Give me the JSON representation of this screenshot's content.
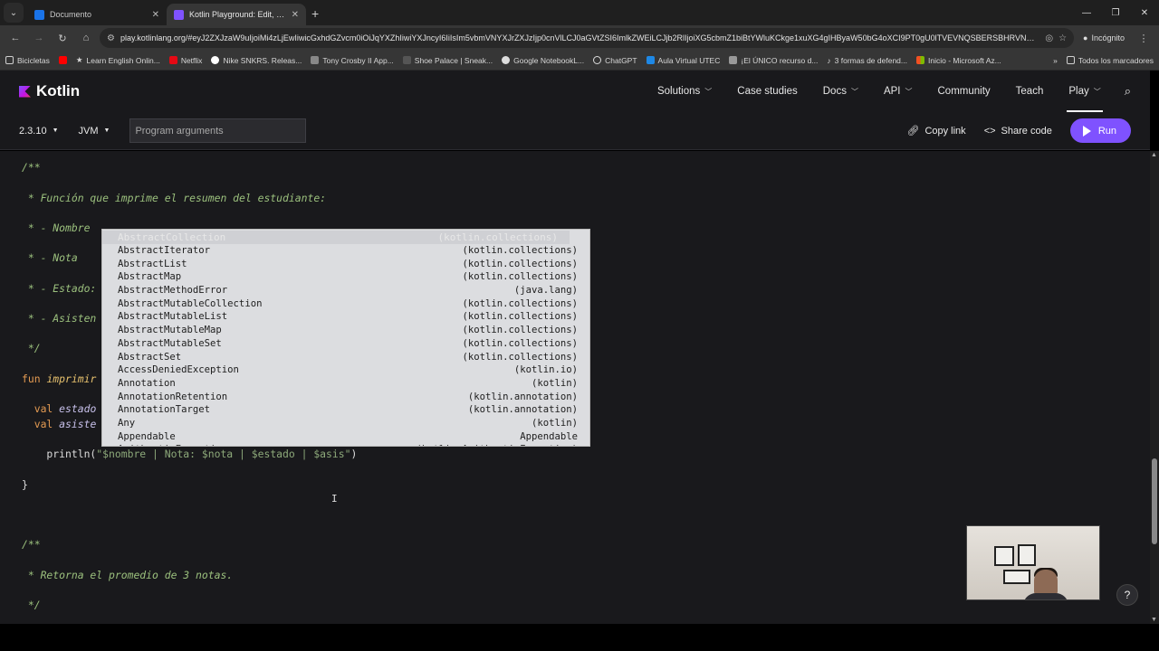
{
  "browser": {
    "tabs": [
      {
        "title": "Documento",
        "favicon_color": "#1a73e8",
        "active": false
      },
      {
        "title": "Kotlin Playground: Edit, Run, Sh",
        "favicon_color": "#7f52ff",
        "active": true
      }
    ],
    "url": "play.kotlinlang.org/#eyJ2ZXJzaW9uIjoiMi4zLjEwIiwicGxhdGZvcm0iOiJqYXZhIiwiYXJncyI6IiIsIm5vbmVNYXJrZXJzIjp0cnVlLCJ0aGVtZSI6ImlkZWEiLCJjb2RlIjoiXG5cbmZ1biBtYWluKCkge1xuXG4gIHByaW50bG4oXCI9PT0gU0lTVEVNQSBERSBHRVNUSU9OIERFIE",
    "incognito_label": "Incógnito",
    "bookmarks": [
      {
        "label": "Bicicletas",
        "color": "#cfcfcf"
      },
      {
        "label": "Learn English Onlin...",
        "color": "#ff0000"
      },
      {
        "label": "Learn English Onlin...",
        "color": "#cfcfcf"
      },
      {
        "label": "Netflix",
        "color": "#e50914"
      },
      {
        "label": "Nike SNKRS. Releas...",
        "color": "#ffffff"
      },
      {
        "label": "Tony Crosby II App...",
        "color": "#cfcfcf"
      },
      {
        "label": "Shoe Palace | Sneak...",
        "color": "#333333"
      },
      {
        "label": "Google NotebookL...",
        "color": "#cfcfcf"
      },
      {
        "label": "ChatGPT",
        "color": "#cfcfcf"
      },
      {
        "label": "Aula Virtual UTEC",
        "color": "#1e88e5"
      },
      {
        "label": "¡El ÚNICO recurso d...",
        "color": "#cfcfcf"
      },
      {
        "label": "3 formas de defend...",
        "color": "#cfcfcf"
      },
      {
        "label": "Inicio - Microsoft Az...",
        "color": "#f25022"
      }
    ],
    "all_bookmarks_label": "Todos los marcadores"
  },
  "kotlin": {
    "logo": "Kotlin",
    "nav": [
      {
        "label": "Solutions",
        "dropdown": true
      },
      {
        "label": "Case studies",
        "dropdown": false
      },
      {
        "label": "Docs",
        "dropdown": true
      },
      {
        "label": "API",
        "dropdown": true
      },
      {
        "label": "Community",
        "dropdown": false
      },
      {
        "label": "Teach",
        "dropdown": false
      },
      {
        "label": "Play",
        "dropdown": true
      }
    ],
    "toolbar": {
      "version": "2.3.10",
      "platform": "JVM",
      "args_placeholder": "Program arguments",
      "copy_link": "Copy link",
      "share_code": "Share code",
      "run": "Run"
    }
  },
  "code_lines": [
    {
      "t": "/**",
      "c": "cm"
    },
    {
      "t": "",
      "c": "cm"
    },
    {
      "t": " * Función que imprime el resumen del estudiante:",
      "c": "cm"
    },
    {
      "t": "",
      "c": "cm"
    },
    {
      "t": " * - Nombre",
      "c": "cm"
    },
    {
      "t": "",
      "c": "cm"
    },
    {
      "t": " * - Nota",
      "c": "cm"
    },
    {
      "t": "",
      "c": "cm"
    },
    {
      "t": " * - Estado:",
      "c": "cm"
    },
    {
      "t": "",
      "c": "cm"
    },
    {
      "t": " * - Asisten",
      "c": "cm"
    },
    {
      "t": "",
      "c": "cm"
    },
    {
      "t": " */",
      "c": "cm"
    },
    {
      "t": "",
      "c": "cm"
    }
  ],
  "code_fn": {
    "kw": "fun ",
    "name": "imprimir"
  },
  "code_vals": [
    {
      "kw": "  val ",
      "name": "estado"
    },
    {
      "kw": "  val ",
      "name": "asiste"
    }
  ],
  "code_println": {
    "fn": "    println(",
    "str": "\"$nombre | Nota: $nota | $estado | $asis\"",
    "end": ")"
  },
  "code_close": "}",
  "code_tail": [
    {
      "t": "/**"
    },
    {
      "t": ""
    },
    {
      "t": " * Retorna el promedio de 3 notas."
    },
    {
      "t": ""
    },
    {
      "t": " */"
    }
  ],
  "autocomplete": [
    {
      "name": "AbstractCollection",
      "pkg": "(kotlin.collections)"
    },
    {
      "name": "AbstractIterator",
      "pkg": "(kotlin.collections)"
    },
    {
      "name": "AbstractList",
      "pkg": "(kotlin.collections)"
    },
    {
      "name": "AbstractMap",
      "pkg": "(kotlin.collections)"
    },
    {
      "name": "AbstractMethodError",
      "pkg": "(java.lang)"
    },
    {
      "name": "AbstractMutableCollection",
      "pkg": "(kotlin.collections)"
    },
    {
      "name": "AbstractMutableList",
      "pkg": "(kotlin.collections)"
    },
    {
      "name": "AbstractMutableMap",
      "pkg": "(kotlin.collections)"
    },
    {
      "name": "AbstractMutableSet",
      "pkg": "(kotlin.collections)"
    },
    {
      "name": "AbstractSet",
      "pkg": "(kotlin.collections)"
    },
    {
      "name": "AccessDeniedException",
      "pkg": "(kotlin.io)"
    },
    {
      "name": "Annotation",
      "pkg": "(kotlin)"
    },
    {
      "name": "AnnotationRetention",
      "pkg": "(kotlin.annotation)"
    },
    {
      "name": "AnnotationTarget",
      "pkg": "(kotlin.annotation)"
    },
    {
      "name": "Any",
      "pkg": "(kotlin)"
    },
    {
      "name": "Appendable",
      "pkg": "Appendable"
    },
    {
      "name": "ArithmeticException",
      "pkg": "(kotlin.ArithmeticException)"
    }
  ],
  "help_label": "?"
}
